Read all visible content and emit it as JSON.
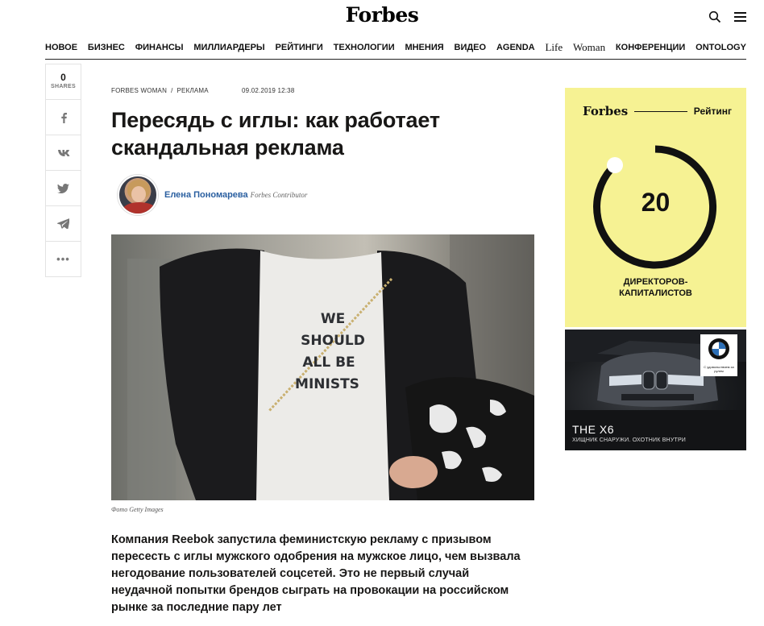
{
  "header": {
    "logo": "Forbes"
  },
  "nav": [
    {
      "label": "НОВОЕ"
    },
    {
      "label": "БИЗНЕС"
    },
    {
      "label": "ФИНАНСЫ"
    },
    {
      "label": "МИЛЛИАРДЕРЫ"
    },
    {
      "label": "РЕЙТИНГИ"
    },
    {
      "label": "ТЕХНОЛОГИИ"
    },
    {
      "label": "МНЕНИЯ"
    },
    {
      "label": "ВИДЕО"
    },
    {
      "label": "AGENDA"
    },
    {
      "label": "Life"
    },
    {
      "label": "Woman"
    },
    {
      "label": "КОНФЕРЕНЦИИ"
    },
    {
      "label": "ONTOLOGY"
    }
  ],
  "share": {
    "count": "0",
    "label": "SHARES"
  },
  "article": {
    "crumb1": "FORBES WOMAN",
    "crumb_sep": "/",
    "crumb2": "РЕКЛАМА",
    "date": "09.02.2019 12:38",
    "title": "Пересядь с иглы: как работает скандальная реклама",
    "author_name": "Елена Пономарева",
    "author_role": "Forbes Contributor",
    "photo_text": [
      "WE",
      "SHOULD",
      "ALL BE",
      "MINISTS"
    ],
    "caption": "Фото Getty Images",
    "lead": "Компания Reebok запустила феминистскую рекламу с призывом пересесть с иглы мужского одобрения на мужское лицо, чем вызвала негодование пользователей соцсетей. Это не первый случай неудачной попытки брендов сыграть на провокации на российском рынке за последние пару лет"
  },
  "ad_rating": {
    "logo": "Forbes",
    "label": "Рейтинг",
    "number": "20",
    "line1": "ДИРЕКТОРОВ-",
    "line2": "КАПИТАЛИСТОВ",
    "bg": "#f6f293"
  },
  "ad_bmw": {
    "model": "THE X6",
    "slogan": "ХИЩНИК СНАРУЖИ. ОХОТНИК ВНУТРИ",
    "tag": "С удовольствием за рулем"
  }
}
